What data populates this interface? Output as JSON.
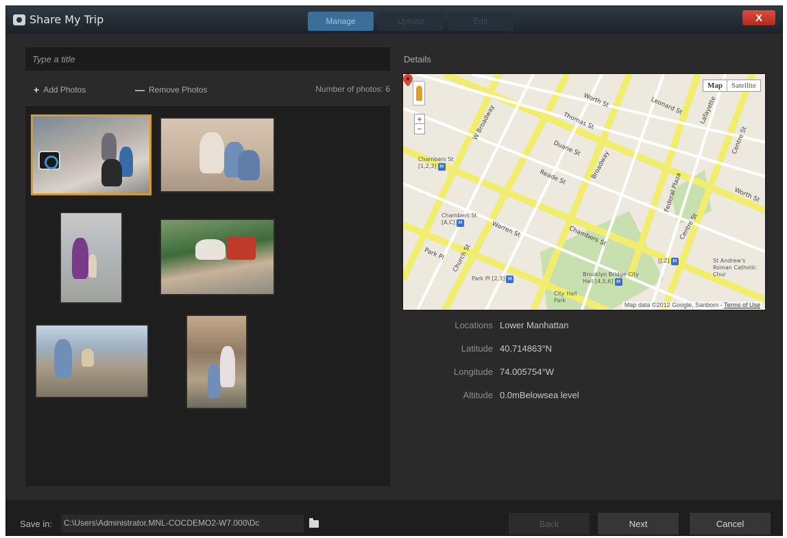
{
  "window": {
    "title": "Share My Trip",
    "tabs": [
      {
        "label": "Manage",
        "active": true
      },
      {
        "label": "Upload",
        "active": false
      },
      {
        "label": "Edit",
        "active": false
      }
    ],
    "close_label": "X"
  },
  "left": {
    "title_placeholder": "Type a title",
    "add_label": "Add Photos",
    "remove_label": "Remove Photos",
    "photo_count": "Number of photos: 6",
    "photos_selected_index": 0
  },
  "details": {
    "label": "Details",
    "map": {
      "map_btn": "Map",
      "satellite_btn": "Satellite",
      "zoom_in": "+",
      "zoom_out": "−",
      "attribution": "Map data ©2012 Google, Sanborn -",
      "terms": "Terms of Use",
      "streets": [
        "Worth St",
        "Leonard St",
        "Thomas St",
        "Duane St",
        "Reade St",
        "Chambers St",
        "Warren St",
        "Park Pl",
        "Church St",
        "Broadway",
        "W Broadway",
        "Federal Plaza",
        "Lafayette",
        "Centre St",
        "Centre St",
        "Worth St"
      ],
      "pois": [
        {
          "text": "Chambers St [1,2,3]",
          "subway": true
        },
        {
          "text": "Chambers St [A,C]",
          "subway": true
        },
        {
          "text": "Park Pl [2,3]",
          "subway": true
        },
        {
          "text": "Brooklyn Bridge City Hall [4,5,6]",
          "subway": true
        },
        {
          "text": "City Hall Park",
          "subway": false
        },
        {
          "text": "St Andrew's Roman Catholic Chur",
          "subway": false
        },
        {
          "text": "[J,Z]",
          "subway": true
        }
      ]
    },
    "location_label": "Locations",
    "location_value": "Lower Manhattan",
    "latitude_label": "Latitude",
    "latitude_value": "40.714863°N",
    "longitude_label": "Longitude",
    "longitude_value": "74.005754°W",
    "altitude_label": "Altitude",
    "altitude_value": "0.0mBelowsea level"
  },
  "bottom": {
    "save_label": "Save in:",
    "save_path": "C:\\Users\\Administrator.MNL-COCDEMO2-W7.000\\Dc",
    "back_label": "Back",
    "next_label": "Next",
    "cancel_label": "Cancel"
  },
  "colors": {
    "selected_border": "#d89a2a",
    "active_tab": "#3a6f9a",
    "close_red": "#d0392b",
    "map_road_major": "#f1ed6e",
    "map_park": "#c8dfb0"
  }
}
